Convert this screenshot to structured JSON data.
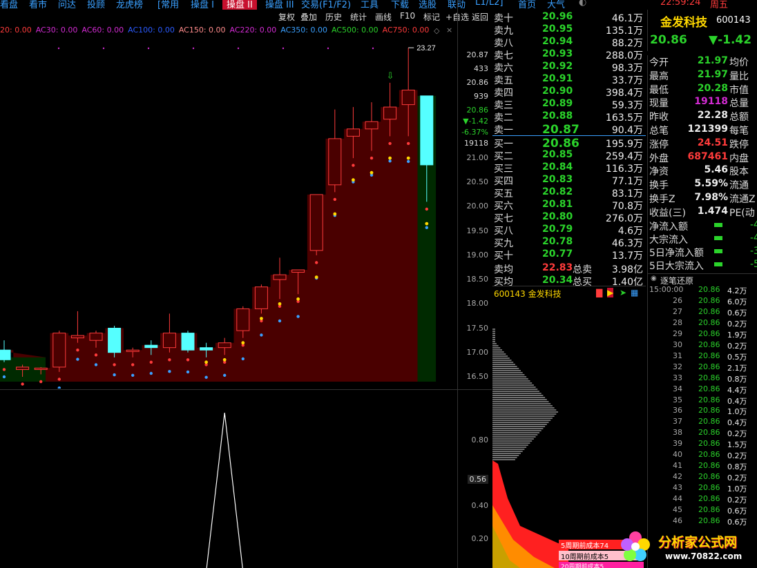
{
  "menu": {
    "items": [
      "看盘",
      "看市",
      "问达",
      "投顾",
      "龙虎榜",
      "[常用",
      "操盘 I",
      "操盘 II",
      "操盘 III",
      "交易(F1/F2)",
      "工具",
      "下载",
      "选股",
      "联动",
      "L1/L2]",
      "首页",
      "大气"
    ],
    "active_index": 7,
    "clock": "22:59:24",
    "weekday": "周五"
  },
  "toolbar": {
    "buttons": [
      "复权",
      "叠加",
      "历史",
      "统计",
      "画线",
      "F10",
      "标记",
      "+自选",
      "返回"
    ]
  },
  "indicators": [
    {
      "label": "20: 0.00",
      "color": "#ff3b3b"
    },
    {
      "label": "AC30: 0.00",
      "color": "#d22bd2"
    },
    {
      "label": "AC60: 0.00",
      "color": "#d22bd2"
    },
    {
      "label": "AC100: 0.00",
      "color": "#2b5bff"
    },
    {
      "label": "AC150: 0.00",
      "color": "#ff8c8c"
    },
    {
      "label": "AC220: 0.00",
      "color": "#d22bd2"
    },
    {
      "label": "AC350: 0.00",
      "color": "#3aa0ff"
    },
    {
      "label": "AC500: 0.00",
      "color": "#2bd32b"
    },
    {
      "label": "AC750: 0.00",
      "color": "#ff3b3b"
    }
  ],
  "price_axis": {
    "labels": [
      "21.00",
      "20.50",
      "20.00",
      "19.50",
      "19.00",
      "18.50",
      "18.00",
      "17.50",
      "17.00",
      "16.50"
    ],
    "side_info": [
      "20.87",
      "433",
      "20.86",
      "939",
      "20.86",
      "▼-1.42",
      "-6.37%",
      "19118"
    ],
    "high_marker": "23.27"
  },
  "sub_axis": {
    "labels": [
      "0.80",
      "0.56",
      "0.40",
      "0.20"
    ]
  },
  "chart_data": {
    "type": "candlestick",
    "candles": [
      {
        "o": 17.05,
        "h": 17.25,
        "l": 16.8,
        "c": 16.85
      },
      {
        "o": 16.65,
        "h": 16.75,
        "l": 16.5,
        "c": 16.7
      },
      {
        "o": 16.65,
        "h": 16.7,
        "l": 16.55,
        "c": 16.68
      },
      {
        "o": 16.7,
        "h": 17.45,
        "l": 16.6,
        "c": 17.4
      },
      {
        "o": 17.3,
        "h": 17.85,
        "l": 17.2,
        "c": 17.35
      },
      {
        "o": 17.25,
        "h": 17.45,
        "l": 17.1,
        "c": 17.4
      },
      {
        "o": 17.5,
        "h": 17.55,
        "l": 16.9,
        "c": 17.0
      },
      {
        "o": 17.02,
        "h": 17.1,
        "l": 16.9,
        "c": 17.05
      },
      {
        "o": 17.15,
        "h": 17.25,
        "l": 16.95,
        "c": 17.1
      },
      {
        "o": 17.1,
        "h": 17.8,
        "l": 17.0,
        "c": 17.4
      },
      {
        "o": 17.4,
        "h": 17.45,
        "l": 17.0,
        "c": 17.05
      },
      {
        "o": 17.1,
        "h": 17.2,
        "l": 16.9,
        "c": 17.05
      },
      {
        "o": 17.1,
        "h": 17.3,
        "l": 16.95,
        "c": 17.2
      },
      {
        "o": 17.45,
        "h": 17.95,
        "l": 17.3,
        "c": 17.9
      },
      {
        "o": 17.9,
        "h": 18.4,
        "l": 17.8,
        "c": 18.35
      },
      {
        "o": 18.5,
        "h": 18.95,
        "l": 18.1,
        "c": 18.6
      },
      {
        "o": 18.65,
        "h": 18.7,
        "l": 18.2,
        "c": 18.7
      },
      {
        "o": 19.1,
        "h": 20.05,
        "l": 19.0,
        "c": 20.25
      },
      {
        "o": 20.45,
        "h": 22.0,
        "l": 20.3,
        "c": 21.4
      },
      {
        "o": 21.45,
        "h": 22.05,
        "l": 21.0,
        "c": 21.6
      },
      {
        "o": 21.6,
        "h": 22.15,
        "l": 21.15,
        "c": 21.75
      },
      {
        "o": 21.8,
        "h": 22.55,
        "l": 21.45,
        "c": 22.05
      },
      {
        "o": 22.1,
        "h": 23.27,
        "l": 21.45,
        "c": 22.4
      },
      {
        "o": 22.28,
        "h": 22.28,
        "l": 20.1,
        "c": 20.86
      }
    ],
    "sub_series": [
      0,
      0,
      0,
      0,
      0,
      0,
      0,
      0,
      0,
      0,
      0,
      0,
      0.97,
      0,
      0,
      0,
      0,
      0,
      0,
      0,
      0,
      0,
      0,
      0
    ],
    "ylim": [
      16.4,
      23.5
    ]
  },
  "stock": {
    "name": "金发科技",
    "code": "600143",
    "price": "20.86",
    "change": "▼-1.42"
  },
  "order_book": {
    "asks": [
      {
        "label": "卖十",
        "price": "20.96",
        "vol": "46.1万"
      },
      {
        "label": "卖九",
        "price": "20.95",
        "vol": "135.1万"
      },
      {
        "label": "卖八",
        "price": "20.94",
        "vol": "88.2万"
      },
      {
        "label": "卖七",
        "price": "20.93",
        "vol": "288.0万"
      },
      {
        "label": "卖六",
        "price": "20.92",
        "vol": "98.3万"
      },
      {
        "label": "卖五",
        "price": "20.91",
        "vol": "33.7万"
      },
      {
        "label": "卖四",
        "price": "20.90",
        "vol": "398.4万"
      },
      {
        "label": "卖三",
        "price": "20.89",
        "vol": "59.3万"
      },
      {
        "label": "卖二",
        "price": "20.88",
        "vol": "163.5万"
      },
      {
        "label": "卖一",
        "price": "20.87",
        "vol": "90.4万"
      }
    ],
    "bids": [
      {
        "label": "买一",
        "price": "20.86",
        "vol": "195.9万"
      },
      {
        "label": "买二",
        "price": "20.85",
        "vol": "259.4万"
      },
      {
        "label": "买三",
        "price": "20.84",
        "vol": "116.3万"
      },
      {
        "label": "买四",
        "price": "20.83",
        "vol": "77.1万"
      },
      {
        "label": "买五",
        "price": "20.82",
        "vol": "83.1万"
      },
      {
        "label": "买六",
        "price": "20.81",
        "vol": "70.8万"
      },
      {
        "label": "买七",
        "price": "20.80",
        "vol": "276.0万"
      },
      {
        "label": "买八",
        "price": "20.79",
        "vol": "4.6万"
      },
      {
        "label": "买九",
        "price": "20.78",
        "vol": "46.3万"
      },
      {
        "label": "买十",
        "price": "20.77",
        "vol": "13.7万"
      }
    ],
    "avg_ask": {
      "label": "卖均",
      "price": "22.83",
      "tlabel": "总卖",
      "vol": "3.98亿"
    },
    "avg_bid": {
      "label": "买均",
      "price": "20.34",
      "tlabel": "总买",
      "vol": "1.40亿"
    }
  },
  "info": {
    "rows": [
      {
        "label": "今开",
        "value": "21.97",
        "tail": "均价",
        "color": "g"
      },
      {
        "label": "最高",
        "value": "21.97",
        "tail": "量比",
        "color": "g"
      },
      {
        "label": "最低",
        "value": "20.28",
        "tail": "市值",
        "color": "g"
      },
      {
        "label": "现量",
        "value": "19118",
        "tail": "总量",
        "color": "m"
      },
      {
        "label": "昨收",
        "value": "22.28",
        "tail": "总额",
        "color": "w"
      },
      {
        "label": "总笔",
        "value": "121399",
        "tail": "每笔",
        "color": "w"
      },
      {
        "label": "涨停",
        "value": "24.51",
        "tail": "跌停",
        "color": "r"
      },
      {
        "label": "外盘",
        "value": "687461",
        "tail": "内盘",
        "color": "r"
      },
      {
        "label": "净资",
        "value": "5.46",
        "tail": "股本",
        "color": "w"
      },
      {
        "label": "换手",
        "value": "5.59%",
        "tail": "流通",
        "color": "w"
      },
      {
        "label": "换手Z",
        "value": "7.98%",
        "tail": "流通Z",
        "color": "w"
      },
      {
        "label": "收益(三)",
        "value": "1.474",
        "tail": "PE(动",
        "color": "w"
      }
    ],
    "flows": [
      "净流入额",
      "大宗流入",
      "5日净流入额",
      "5日大宗流入"
    ],
    "flow_vals": [
      "-4",
      "-4",
      "-3",
      "-5"
    ]
  },
  "tick_panel": {
    "title": "逐笔还原",
    "first_time": "15:00:00",
    "rows": [
      {
        "t": "",
        "p": "20.86",
        "v": "4.2万"
      },
      {
        "t": "26",
        "p": "20.86",
        "v": "6.0万"
      },
      {
        "t": "27",
        "p": "20.86",
        "v": "0.6万"
      },
      {
        "t": "28",
        "p": "20.86",
        "v": "0.2万"
      },
      {
        "t": "29",
        "p": "20.86",
        "v": "1.9万"
      },
      {
        "t": "30",
        "p": "20.86",
        "v": "0.2万"
      },
      {
        "t": "31",
        "p": "20.86",
        "v": "0.5万"
      },
      {
        "t": "32",
        "p": "20.86",
        "v": "2.1万"
      },
      {
        "t": "33",
        "p": "20.86",
        "v": "0.8万"
      },
      {
        "t": "34",
        "p": "20.86",
        "v": "4.4万"
      },
      {
        "t": "35",
        "p": "20.86",
        "v": "0.4万"
      },
      {
        "t": "36",
        "p": "20.86",
        "v": "1.0万"
      },
      {
        "t": "37",
        "p": "20.86",
        "v": "0.4万"
      },
      {
        "t": "38",
        "p": "20.86",
        "v": "0.2万"
      },
      {
        "t": "39",
        "p": "20.86",
        "v": "1.5万"
      },
      {
        "t": "40",
        "p": "20.86",
        "v": "0.2万"
      },
      {
        "t": "41",
        "p": "20.86",
        "v": "0.8万"
      },
      {
        "t": "42",
        "p": "20.86",
        "v": "0.2万"
      },
      {
        "t": "43",
        "p": "20.86",
        "v": "1.0万"
      },
      {
        "t": "44",
        "p": "20.86",
        "v": "0.2万"
      },
      {
        "t": "45",
        "p": "20.86",
        "v": "0.6万"
      },
      {
        "t": "46",
        "p": "20.86",
        "v": "0.6万"
      }
    ]
  },
  "chip_panel": {
    "title": "600143 金发科技",
    "legend": [
      "5周期前成本74",
      "10周期前成本5",
      "20周期前成本5"
    ]
  },
  "watermark": {
    "text": "分析家公式网",
    "url": "www.70822.com"
  }
}
